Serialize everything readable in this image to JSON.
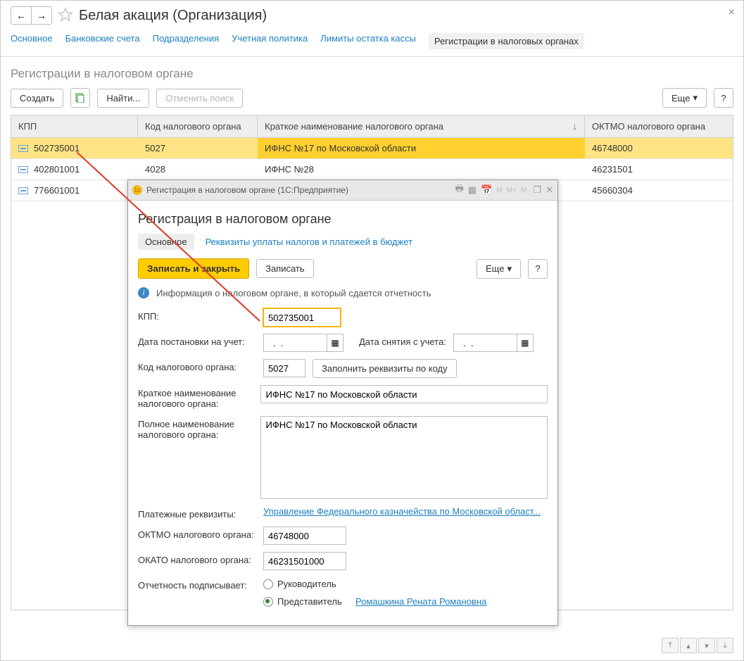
{
  "header": {
    "title": "Белая акация (Организация)"
  },
  "nav_tabs": {
    "main": "Основное",
    "bank": "Банковские счета",
    "divisions": "Подразделения",
    "policy": "Учетная политика",
    "limits": "Лимиты остатка кассы",
    "reg": "Регистрации в налоговых органах"
  },
  "section": {
    "title": "Регистрации в налоговом органе"
  },
  "toolbar": {
    "create": "Создать",
    "find": "Найти...",
    "cancel_find": "Отменить поиск",
    "more": "Еще",
    "help": "?"
  },
  "table": {
    "headers": {
      "kpp": "КПП",
      "code": "Код налогового органа",
      "name": "Краткое наименование налогового органа",
      "oktmo": "ОКТМО налогового органа"
    },
    "rows": [
      {
        "kpp": "502735001",
        "code": "5027",
        "name": "ИФНС №17 по Московской области",
        "oktmo": "46748000"
      },
      {
        "kpp": "402801001",
        "code": "4028",
        "name": "ИФНС №28",
        "oktmo": "46231501"
      },
      {
        "kpp": "776601001",
        "code": "",
        "name": "",
        "oktmo": "45660304"
      }
    ]
  },
  "dialog": {
    "titlebar": "Регистрация в налоговом органе  (1С:Предприятие)",
    "heading": "Регистрация в налоговом органе",
    "tabs": {
      "main": "Основное",
      "props": "Реквизиты уплаты налогов и платежей в бюджет"
    },
    "buttons": {
      "save_close": "Записать и закрыть",
      "save": "Записать",
      "more": "Еще",
      "help": "?"
    },
    "info": "Информация о налоговом органе, в который сдается отчетность",
    "labels": {
      "kpp": "КПП:",
      "reg_date": "Дата постановки на учет:",
      "dereg_date": "Дата снятия с учета:",
      "code": "Код налогового органа:",
      "fill_by_code": "Заполнить реквизиты по коду",
      "short_name": "Краткое наименование налогового органа:",
      "full_name": "Полное наименование налогового органа:",
      "pay_props": "Платежные реквизиты:",
      "oktmo": "ОКТМО налогового органа:",
      "okato": "ОКАТО налогового органа:",
      "signer": "Отчетность подписывает:",
      "signer_head": "Руководитель",
      "signer_rep": "Представитель"
    },
    "values": {
      "kpp": "502735001",
      "reg_date": "  .  .",
      "dereg_date": "  .  .",
      "code": "5027",
      "short_name": "ИФНС №17 по Московской области",
      "full_name": "ИФНС №17 по Московской области",
      "pay_link": "Управление Федерального казначейства по Московской област...",
      "oktmo": "46748000",
      "okato": "46231501000",
      "rep_link": "Ромашкина Рената Романовна"
    }
  }
}
